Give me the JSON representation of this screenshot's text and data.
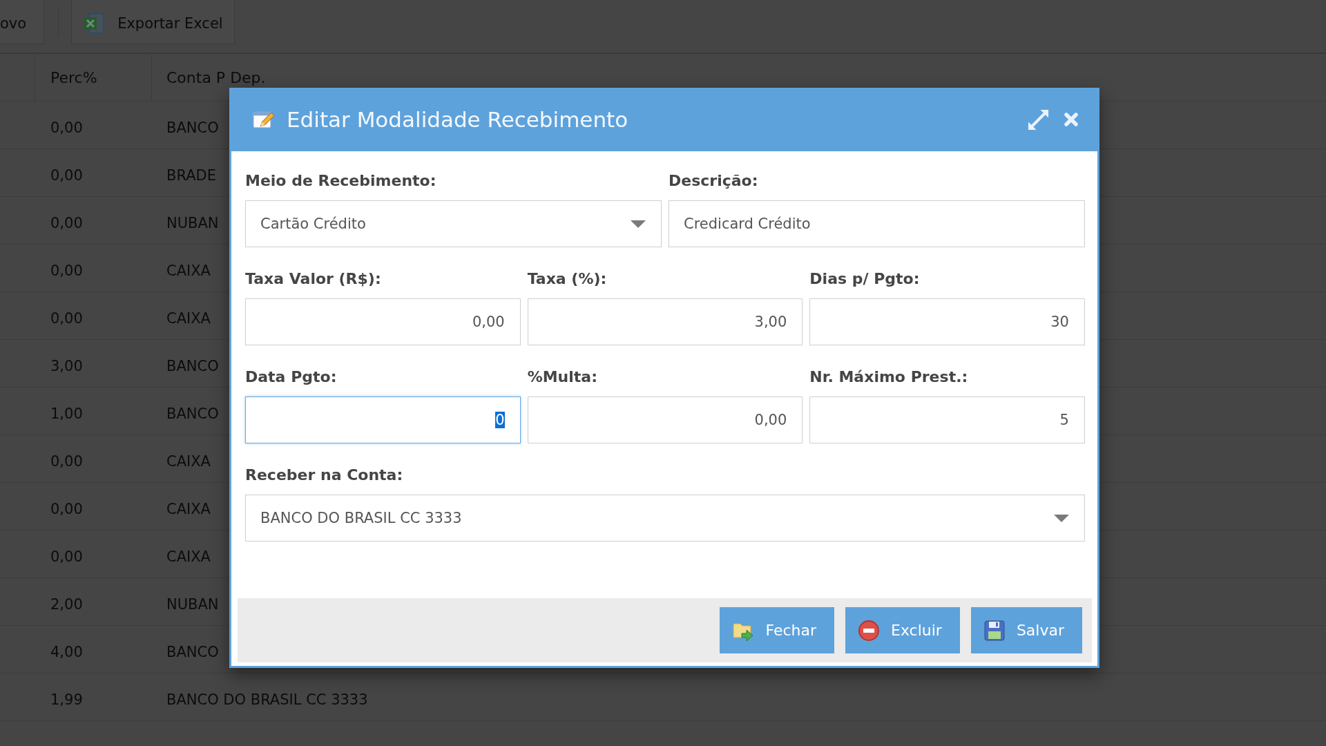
{
  "toolbar": {
    "buttons": [
      {
        "label": "ovo",
        "kind": "plain"
      },
      {
        "label": "Exportar Excel",
        "kind": "excel"
      }
    ]
  },
  "table": {
    "columns": [
      "Perc%",
      "Conta P Dep."
    ],
    "rows": [
      {
        "perc": "0,00",
        "conta": "BANCO"
      },
      {
        "perc": "0,00",
        "conta": "BRADE"
      },
      {
        "perc": "0,00",
        "conta": "NUBAN"
      },
      {
        "perc": "0,00",
        "conta": "CAIXA"
      },
      {
        "perc": "0,00",
        "conta": "CAIXA"
      },
      {
        "perc": "3,00",
        "conta": "BANCO"
      },
      {
        "perc": "1,00",
        "conta": "BANCO"
      },
      {
        "perc": "0,00",
        "conta": "CAIXA"
      },
      {
        "perc": "0,00",
        "conta": "CAIXA"
      },
      {
        "perc": "0,00",
        "conta": "CAIXA"
      },
      {
        "perc": "2,00",
        "conta": "NUBAN"
      },
      {
        "perc": "4,00",
        "conta": "BANCO"
      },
      {
        "perc": "1,99",
        "conta": "BANCO DO BRASIL CC 3333"
      }
    ]
  },
  "dialog": {
    "title": "Editar Modalidade Recebimento",
    "field_rows": [
      [
        {
          "label": "Meio de Recebimento:",
          "kind": "select",
          "value": "Cartão Crédito",
          "focused": false
        },
        {
          "label": "Descrição:",
          "kind": "text",
          "value": "Credicard Crédito",
          "focused": false
        }
      ],
      [
        {
          "label": "Taxa Valor (R$):",
          "kind": "number",
          "value": "0,00",
          "focused": false
        },
        {
          "label": "Taxa (%):",
          "kind": "number",
          "value": "3,00",
          "focused": false
        },
        {
          "label": "Dias p/ Pgto:",
          "kind": "number",
          "value": "30",
          "focused": false
        }
      ],
      [
        {
          "label": "Data Pgto:",
          "kind": "number",
          "value": "0",
          "focused": true
        },
        {
          "label": "%Multa:",
          "kind": "number",
          "value": "0,00",
          "focused": false
        },
        {
          "label": "Nr. Máximo Prest.:",
          "kind": "number",
          "value": "5",
          "focused": false
        }
      ],
      [
        {
          "label": "Receber na Conta:",
          "kind": "select",
          "value": "BANCO DO BRASIL CC 3333",
          "focused": false
        }
      ]
    ],
    "buttons": [
      {
        "label": "Fechar",
        "kind": "close"
      },
      {
        "label": "Excluir",
        "kind": "delete"
      },
      {
        "label": "Salvar",
        "kind": "save"
      }
    ]
  }
}
